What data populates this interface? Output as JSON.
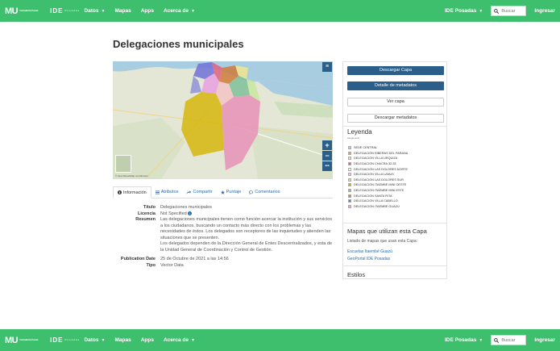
{
  "nav": {
    "logo_mu": "MU",
    "logo_mu_sub": "Municipalidad de Posadas",
    "logo_ide": "IDE",
    "logo_ide_sub": "Posadas",
    "items": [
      "Datos",
      "Mapas",
      "Apps",
      "Acerca de"
    ],
    "region": "IDE Posadas",
    "search_placeholder": "Buscar",
    "login": "Ingresar"
  },
  "page": {
    "title": "Delegaciones municipales"
  },
  "map": {
    "layers_icon": "layers-icon",
    "zoom_in": "+",
    "zoom_out": "−",
    "more": "•••",
    "attribution": "© OpenStreetMap contributors"
  },
  "tabs": [
    {
      "label": "Información",
      "icon": "info-icon"
    },
    {
      "label": "Atributos",
      "icon": "list-icon"
    },
    {
      "label": "Compartir",
      "icon": "share-icon"
    },
    {
      "label": "Puntaje",
      "icon": "star-icon"
    },
    {
      "label": "Comentarios",
      "icon": "comment-icon"
    }
  ],
  "meta": {
    "title_label": "Título",
    "title_value": "Delegaciones municipales",
    "license_label": "Licencia",
    "license_value": "Not Specified",
    "summary_label": "Resumen",
    "summary_p1": "Las delegaciones municipales tienen como función acercar la institución y sus servicios a los ciudadanos, buscando un contacto más directo con los problemas y las necesidades de éstos. Los delegados son receptores de las inquietudes y atienden las situaciones que se presenten.",
    "summary_p2": "Los delegados dependen de la Dirección General de Entes Descentralizados, y esta de la Unidad General de Coordinación y Control de Gestión.",
    "pubdate_label": "Publication Date",
    "pubdate_value": "25 de Octubre de 2021 a las 14:56",
    "type_label": "Tipo",
    "type_value": "Vector Data"
  },
  "sidebar": {
    "btn_download": "Descargar Capa",
    "btn_metadata_detail": "Detalle de metadatos",
    "btn_view": "Ver capa",
    "btn_download_meta": "Descargar metadatos",
    "legend_title": "Leyenda",
    "legend_sub": "asegeneral",
    "legend": [
      {
        "label": "SEDE CENTRAL",
        "color": "#c9c9c9"
      },
      {
        "label": "DELEGACION RIBERAS DEL PARANA",
        "color": "#e89a7a"
      },
      {
        "label": "DELEGACION VILLA URQUIZA",
        "color": "#f0e68c"
      },
      {
        "label": "DELEGACION CHACRA 32-33",
        "color": "#e06080"
      },
      {
        "label": "DELEGACION LAS DOLORES NORTE",
        "color": "#fff6d8"
      },
      {
        "label": "DELEGACION VILLA LANUS",
        "color": "#f3c4c4"
      },
      {
        "label": "DELEGACION LAS DOLORES SUR",
        "color": "#c8e6a0"
      },
      {
        "label": "DELEGACION ITAEMBE MINI OESTE",
        "color": "#d4b400"
      },
      {
        "label": "DELEGACION ITAEMBE MINI ESTE",
        "color": "#7fbf9a"
      },
      {
        "label": "DELEGACION SANTA RITA",
        "color": "#cf7a3a"
      },
      {
        "label": "DELEGACION VILLA CABELLO",
        "color": "#7070d8"
      },
      {
        "label": "DELEGACION ITAEMBE GUAZU",
        "color": "#e7a0e0"
      }
    ],
    "maps_title": "Mapas que utilizan esta Capa",
    "maps_text": "Listado de mapas que usan esta Capa:",
    "maps_link1": "Escuelas Itaembé Guazú",
    "maps_link2": "GeoPortal IDE Posadas",
    "styles_title": "Estilos"
  }
}
